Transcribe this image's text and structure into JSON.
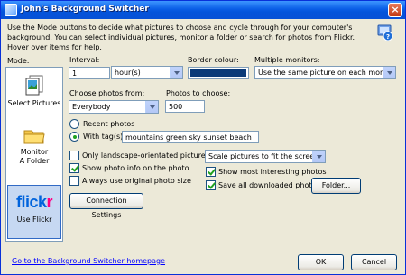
{
  "window": {
    "title": "John's Background Switcher"
  },
  "instructions": "Use the Mode buttons to decide what pictures to choose and cycle through for your computer's background. You can select individual pictures, monitor a folder or search for photos from Flickr. Hover over items for help.",
  "mode": {
    "label": "Mode:",
    "buttons": [
      {
        "label": "Select Pictures",
        "icon": "pictures-icon"
      },
      {
        "label": "Monitor A Folder",
        "icon": "folder-icon"
      },
      {
        "label": "Use Flickr",
        "icon": "flickr-logo",
        "selected": true
      }
    ],
    "flickr_logo_text": "flickr"
  },
  "interval": {
    "label": "Interval:",
    "value": "1",
    "unit": "hour(s)"
  },
  "border_colour": {
    "label": "Border colour:",
    "value": "#0a3a78"
  },
  "multiple_monitors": {
    "label": "Multiple monitors:",
    "value": "Use the same picture on each monitor"
  },
  "choose_from": {
    "label": "Choose photos from:",
    "value": "Everybody"
  },
  "photos_to_choose": {
    "label": "Photos to choose:",
    "value": "500"
  },
  "radios": {
    "recent_label": "Recent photos",
    "tags_label": "With tag(s):",
    "tags_value": "mountains green sky sunset beach",
    "selected": "tags"
  },
  "checkboxes": {
    "landscape": {
      "label": "Only landscape-orientated pictures",
      "checked": false
    },
    "photo_info": {
      "label": "Show photo info on the photo",
      "checked": true
    },
    "original_size": {
      "label": "Always use original photo size",
      "checked": false
    },
    "interesting": {
      "label": "Show most interesting photos",
      "checked": true
    },
    "save_all": {
      "label": "Save all downloaded photos",
      "checked": true
    }
  },
  "scale": {
    "value": "Scale pictures to fit the screen"
  },
  "buttons": {
    "folder": "Folder...",
    "connection": "Connection Settings",
    "ok": "OK",
    "cancel": "Cancel"
  },
  "footer_link": "Go to the Background Switcher homepage",
  "colors": {
    "title_bar": "#0a5ee6",
    "flickr_blue": "#0063dc",
    "flickr_pink": "#ff0084"
  }
}
